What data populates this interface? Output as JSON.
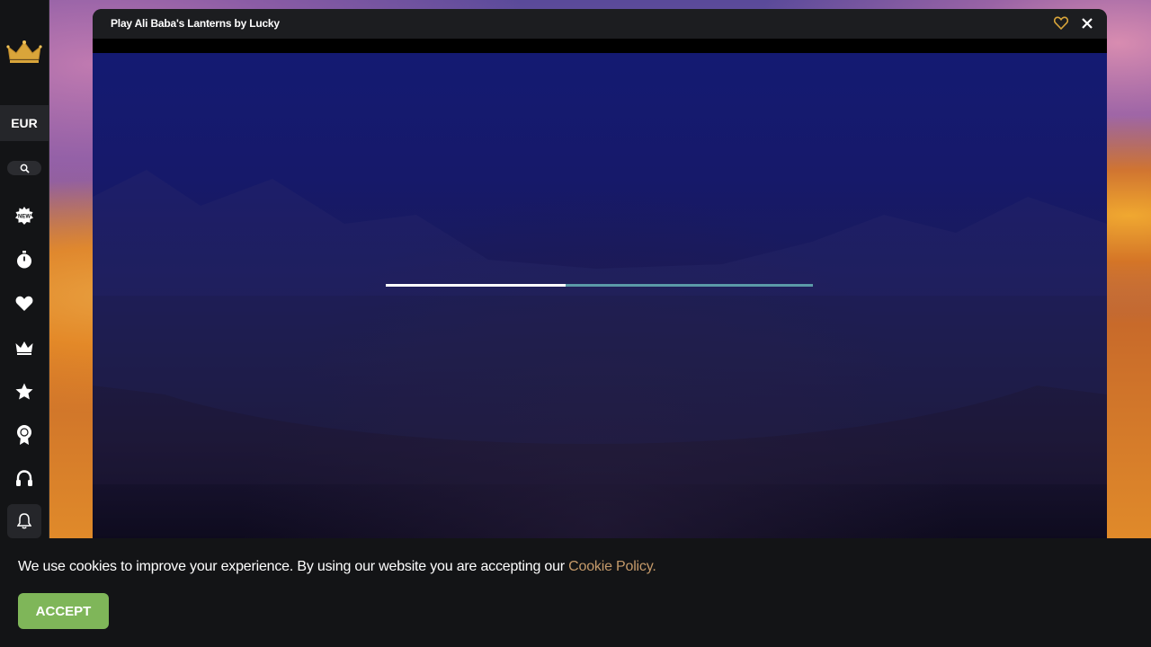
{
  "sidebar": {
    "logo_icon": "crown-icon",
    "currency": "EUR",
    "search_icon": "search-icon",
    "items": [
      {
        "icon": "new-badge-icon",
        "name": "new-games"
      },
      {
        "icon": "stopwatch-icon",
        "name": "recent"
      },
      {
        "icon": "heart-icon",
        "name": "favorites"
      },
      {
        "icon": "crown-icon",
        "name": "vip"
      },
      {
        "icon": "star-icon",
        "name": "top"
      },
      {
        "icon": "award-icon",
        "name": "rewards"
      },
      {
        "icon": "headset-icon",
        "name": "support"
      },
      {
        "icon": "bell-icon",
        "name": "notifications"
      }
    ]
  },
  "modal": {
    "title": "Play Ali Baba's Lanterns by Lucky",
    "favorite_icon": "heart-outline-icon",
    "close_icon": "close-icon",
    "loading_progress": 0.42
  },
  "cookie": {
    "text": "We use cookies to improve your experience. By using our website you are accepting our ",
    "link": "Cookie Policy.",
    "accept_label": "ACCEPT"
  },
  "colors": {
    "accent_gold": "#d9a53a",
    "accept_green": "#7fb659",
    "link_color": "#c59a6a",
    "progress_track": "#5b9aa8"
  }
}
